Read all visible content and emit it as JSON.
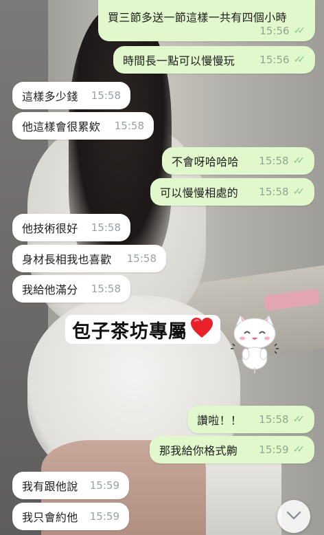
{
  "messages": [
    {
      "id": "m1",
      "dir": "out",
      "text": "買三節多送一節這樣一共有四個小時",
      "time": "15:56",
      "read": true
    },
    {
      "id": "m2",
      "dir": "out",
      "text": "時間長一點可以慢慢玩",
      "time": "15:56",
      "read": true
    },
    {
      "id": "m3",
      "dir": "in",
      "text": "這樣多少錢",
      "time": "15:58"
    },
    {
      "id": "m4",
      "dir": "in",
      "text": "他這樣會很累欸",
      "time": "15:58"
    },
    {
      "id": "m5",
      "dir": "out",
      "text": "不會呀哈哈哈",
      "time": "15:58",
      "read": true
    },
    {
      "id": "m6",
      "dir": "out",
      "text": "可以慢慢相處的",
      "time": "15:58",
      "read": true
    },
    {
      "id": "m7",
      "dir": "in",
      "text": "他技術很好",
      "time": "15:58"
    },
    {
      "id": "m8",
      "dir": "in",
      "text": "身材長相我也喜歡",
      "time": "15:58"
    },
    {
      "id": "m9",
      "dir": "in",
      "text": "我給他滿分",
      "time": "15:58"
    },
    {
      "id": "m10",
      "dir": "out",
      "text": "讚啦！！",
      "time": "15:58",
      "read": true
    },
    {
      "id": "m11",
      "dir": "out",
      "text": "那我給你格式齁",
      "time": "15:59",
      "read": true
    },
    {
      "id": "m12",
      "dir": "in",
      "text": "我有跟他說",
      "time": "15:59"
    },
    {
      "id": "m13",
      "dir": "in",
      "text": "我只會約他",
      "time": "15:59"
    }
  ],
  "overlay": {
    "label": "包子茶坊專屬",
    "heart_icon": "heart-icon"
  },
  "sticker": {
    "icon": "cat-sticker-icon"
  },
  "scroll_button": {
    "icon": "chevron-down-icon"
  },
  "colors": {
    "outgoing": "#e0f8cc",
    "incoming": "#ffffff",
    "read_check": "#8bc48a",
    "heart": "#e8212b"
  }
}
